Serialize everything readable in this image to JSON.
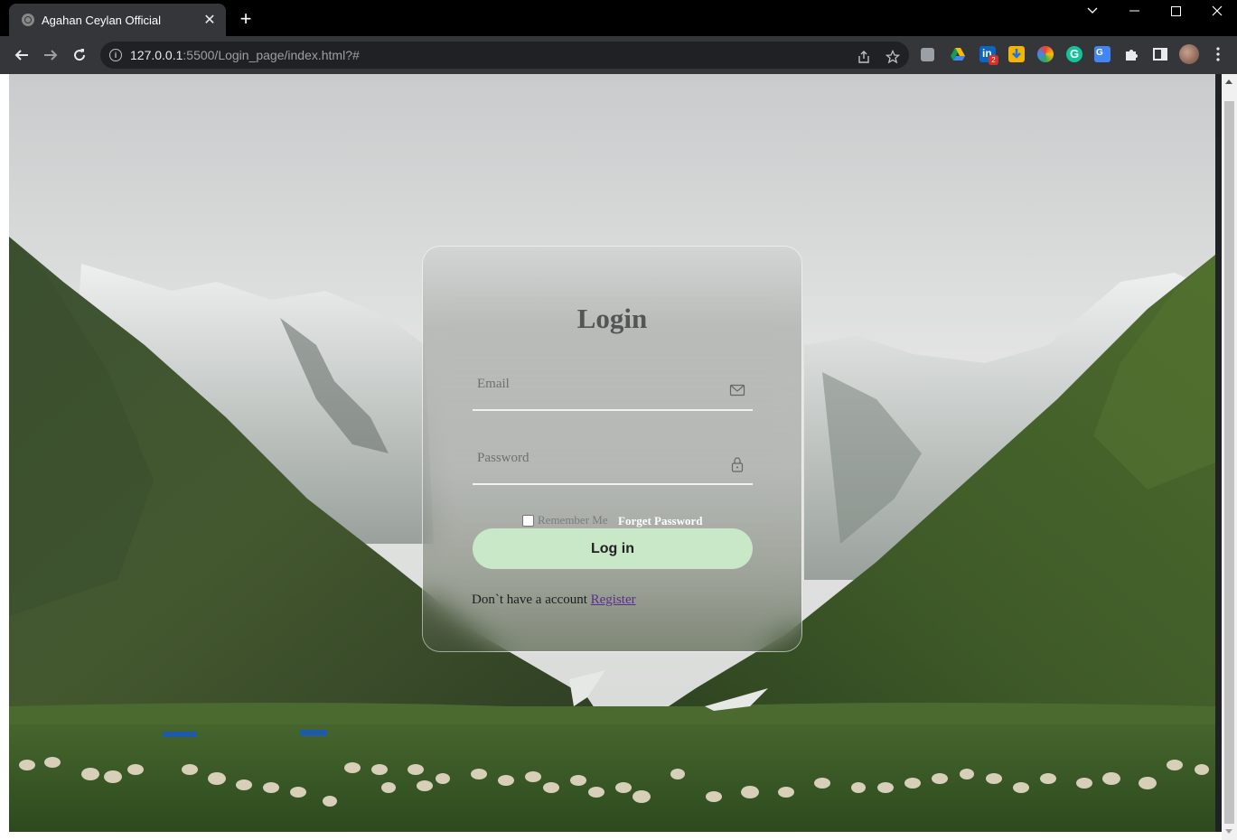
{
  "browser": {
    "tab_title": "Agahan Ceylan Official",
    "url_host": "127.0.0.1",
    "url_path": ":5500/Login_page/index.html?#",
    "extension_badge": "2"
  },
  "login": {
    "title": "Login",
    "email_placeholder": "Email",
    "password_placeholder": "Password",
    "remember_label": "Remember Me",
    "forget_label": "Forget Password",
    "button_label": "Log in",
    "no_account_text": "Don`t have a account",
    "register_label": "Register"
  },
  "colors": {
    "button_bg": "#c8e8c8",
    "link": "#5b2e8e"
  }
}
